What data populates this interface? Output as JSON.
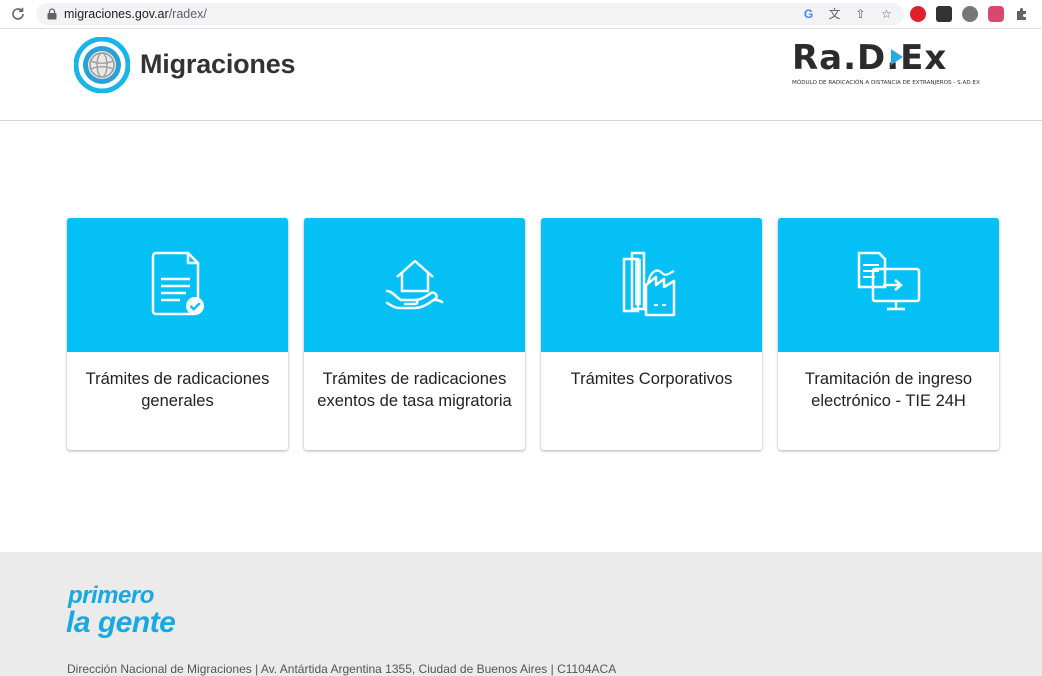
{
  "browser": {
    "url_host": "migraciones.gov.ar",
    "url_path": "/radex/"
  },
  "header": {
    "logo_text": "Migraciones",
    "radex_logo_text": "Ra.D.Ex",
    "radex_subtitle": "MÓDULO DE RADICACIÓN A DISTANCIA DE EXTRANJEROS - S.AD.EX"
  },
  "cards": [
    {
      "label": "Trámites de radicaciones generales",
      "icon": "document-check-icon"
    },
    {
      "label": "Trámites de radicaciones exentos de tasa migratoria",
      "icon": "house-hand-icon"
    },
    {
      "label": "Trámites Corporativos",
      "icon": "buildings-icon"
    },
    {
      "label": "Tramitación de ingreso electrónico - TIE 24H",
      "icon": "document-monitor-icon"
    }
  ],
  "footer": {
    "slogan_line1": "primero",
    "slogan_line2": "la gente",
    "address": "Dirección Nacional de Migraciones | Av. Antártida Argentina 1355, Ciudad de Buenos Aires | C1104ACA"
  },
  "colors": {
    "card_accent": "#04c0f4",
    "slogan": "#1aa8e0"
  }
}
